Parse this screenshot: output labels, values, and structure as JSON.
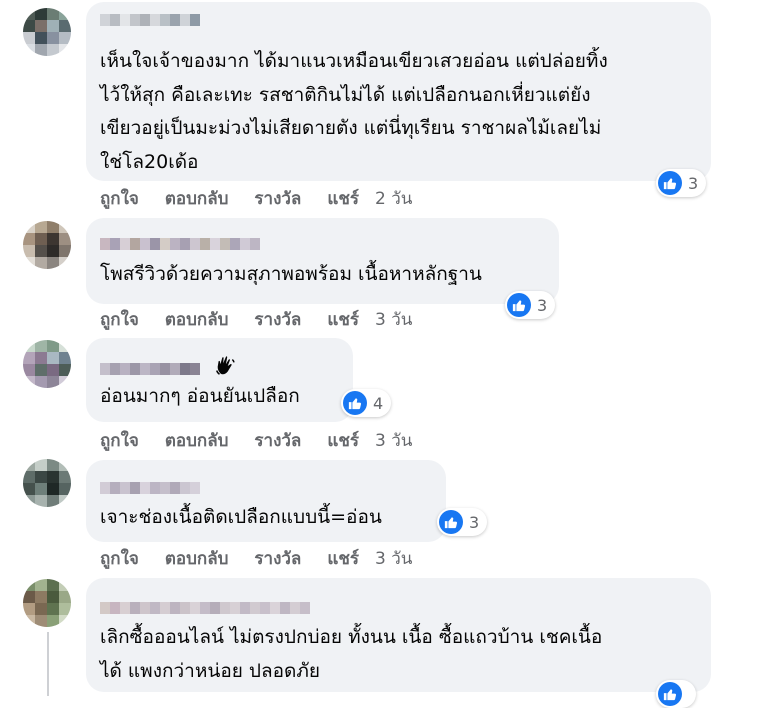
{
  "comments": [
    {
      "author": "",
      "text": "เห็นใจเจ้าของมาก ได้มาแนวเหมือนเขียวเสวยอ่อน แต่ปล่อยทิ้ง\nไว้ให้สุก คือเละเทะ รสชาติกินไม่ได้ แต่เปลือกนอกเหี่ยวแต่ยัง\nเขียวอยู่เป็นมะม่วงไม่เสียดายตัง แต่นี่ทุเรียน ราชาผลไม้เลยไม่\nใช่โล20เด้อ",
      "reaction_count": "3",
      "actions": {
        "like": "ถูกใจ",
        "reply": "ตอบกลับ",
        "award": "รางวัล",
        "share": "แชร์",
        "time": "2 วัน"
      }
    },
    {
      "author": "",
      "text": "โพสรีวิวด้วยความสุภาพอพร้อม เนื้อหาหลักฐาน",
      "reaction_count": "3",
      "actions": {
        "like": "ถูกใจ",
        "reply": "ตอบกลับ",
        "award": "รางวัล",
        "share": "แชร์",
        "time": "3 วัน"
      }
    },
    {
      "author": "",
      "text": "อ่อนมากๆ อ่อนยันเปลือก",
      "reaction_count": "4",
      "actions": {
        "like": "ถูกใจ",
        "reply": "ตอบกลับ",
        "award": "รางวัล",
        "share": "แชร์",
        "time": "3 วัน"
      }
    },
    {
      "author": "",
      "text": "เจาะช่องเนื้อติดเปลือกแบบนี้=อ่อน",
      "reaction_count": "3",
      "actions": {
        "like": "ถูกใจ",
        "reply": "ตอบกลับ",
        "award": "รางวัล",
        "share": "แชร์",
        "time": "3 วัน"
      }
    },
    {
      "author": "",
      "text": "เลิกซื้อออนไลน์ ไม่ตรงปกบ่อย ทั้งนน เนื้อ ซื้อแถวบ้าน เชคเนื้อ\nได้ แพงกว่าหน่อย ปลอดภัย",
      "reaction_count": "",
      "actions": {}
    }
  ],
  "colors": {
    "bubble": "#f0f2f5",
    "text": "#050505",
    "meta": "#65676b",
    "like_blue": "#1877f2"
  },
  "icons": {
    "reaction": "like-thumb-icon",
    "badge": "waving-hand-icon"
  }
}
